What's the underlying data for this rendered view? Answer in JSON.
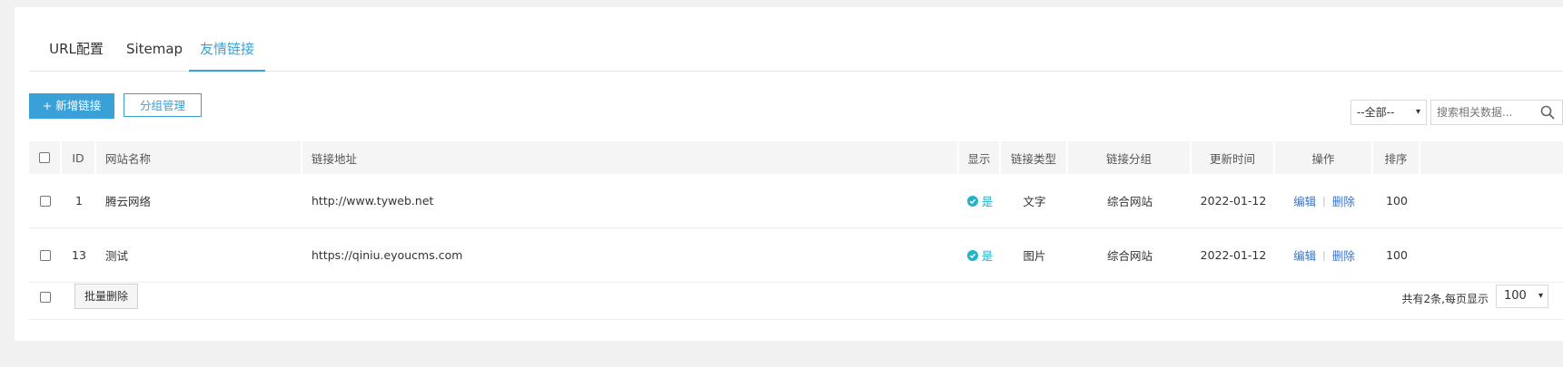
{
  "tabs": [
    {
      "label": "URL配置",
      "active": false
    },
    {
      "label": "Sitemap",
      "active": false
    },
    {
      "label": "友情链接",
      "active": true
    }
  ],
  "toolbar": {
    "add_label": "+ 新增链接",
    "group_label": "分组管理",
    "filter_value": "--全部--",
    "search_placeholder": "搜索相关数据..."
  },
  "table": {
    "headers": {
      "id": "ID",
      "name": "网站名称",
      "url": "链接地址",
      "show": "显示",
      "type": "链接类型",
      "group": "链接分组",
      "updated": "更新时间",
      "actions": "操作",
      "order": "排序"
    },
    "rows": [
      {
        "id": "1",
        "name": "腾云网络",
        "url": "http://www.tyweb.net",
        "show": "是",
        "type": "文字",
        "group": "综合网站",
        "updated": "2022-01-12",
        "edit": "编辑",
        "delete": "删除",
        "order": "100"
      },
      {
        "id": "13",
        "name": "测试",
        "url": "https://qiniu.eyoucms.com",
        "show": "是",
        "type": "图片",
        "group": "综合网站",
        "updated": "2022-01-12",
        "edit": "编辑",
        "delete": "删除",
        "order": "100"
      }
    ]
  },
  "footer": {
    "batch_delete_label": "批量删除",
    "total_text": "共有2条,每页显示",
    "page_size": "100"
  },
  "colors": {
    "accent": "#3aa1d8",
    "status_ok": "#1fb5c9",
    "link": "#3a73c0"
  }
}
